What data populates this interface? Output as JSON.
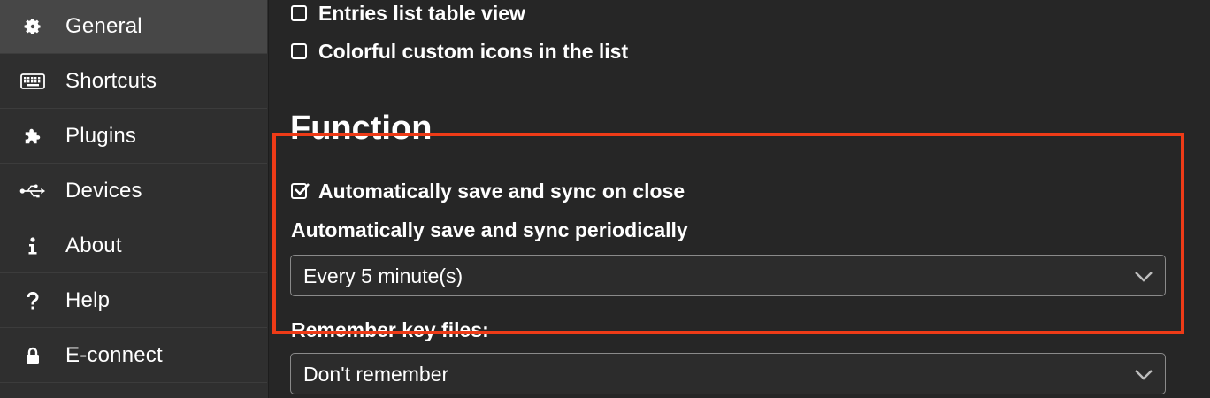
{
  "sidebar": {
    "items": [
      {
        "label": "General",
        "icon": "gear-icon",
        "active": true
      },
      {
        "label": "Shortcuts",
        "icon": "keyboard-icon",
        "active": false
      },
      {
        "label": "Plugins",
        "icon": "puzzle-icon",
        "active": false
      },
      {
        "label": "Devices",
        "icon": "usb-icon",
        "active": false
      },
      {
        "label": "About",
        "icon": "info-icon",
        "active": false
      },
      {
        "label": "Help",
        "icon": "question-icon",
        "active": false
      },
      {
        "label": "E-connect",
        "icon": "lock-icon",
        "active": false
      }
    ]
  },
  "main": {
    "checkboxes_top": [
      {
        "label": "Entries list table view",
        "checked": false
      },
      {
        "label": "Colorful custom icons in the list",
        "checked": false
      }
    ],
    "function_section": {
      "title": "Function",
      "autosave_on_close": {
        "label": "Automatically save and sync on close",
        "checked": true
      },
      "autosave_periodic": {
        "label": "Automatically save and sync periodically",
        "selected": "Every 5 minute(s)"
      },
      "remember_key_files": {
        "label": "Remember key files:",
        "selected": "Don't remember"
      }
    }
  },
  "highlight": {
    "color": "#ee3b17"
  }
}
